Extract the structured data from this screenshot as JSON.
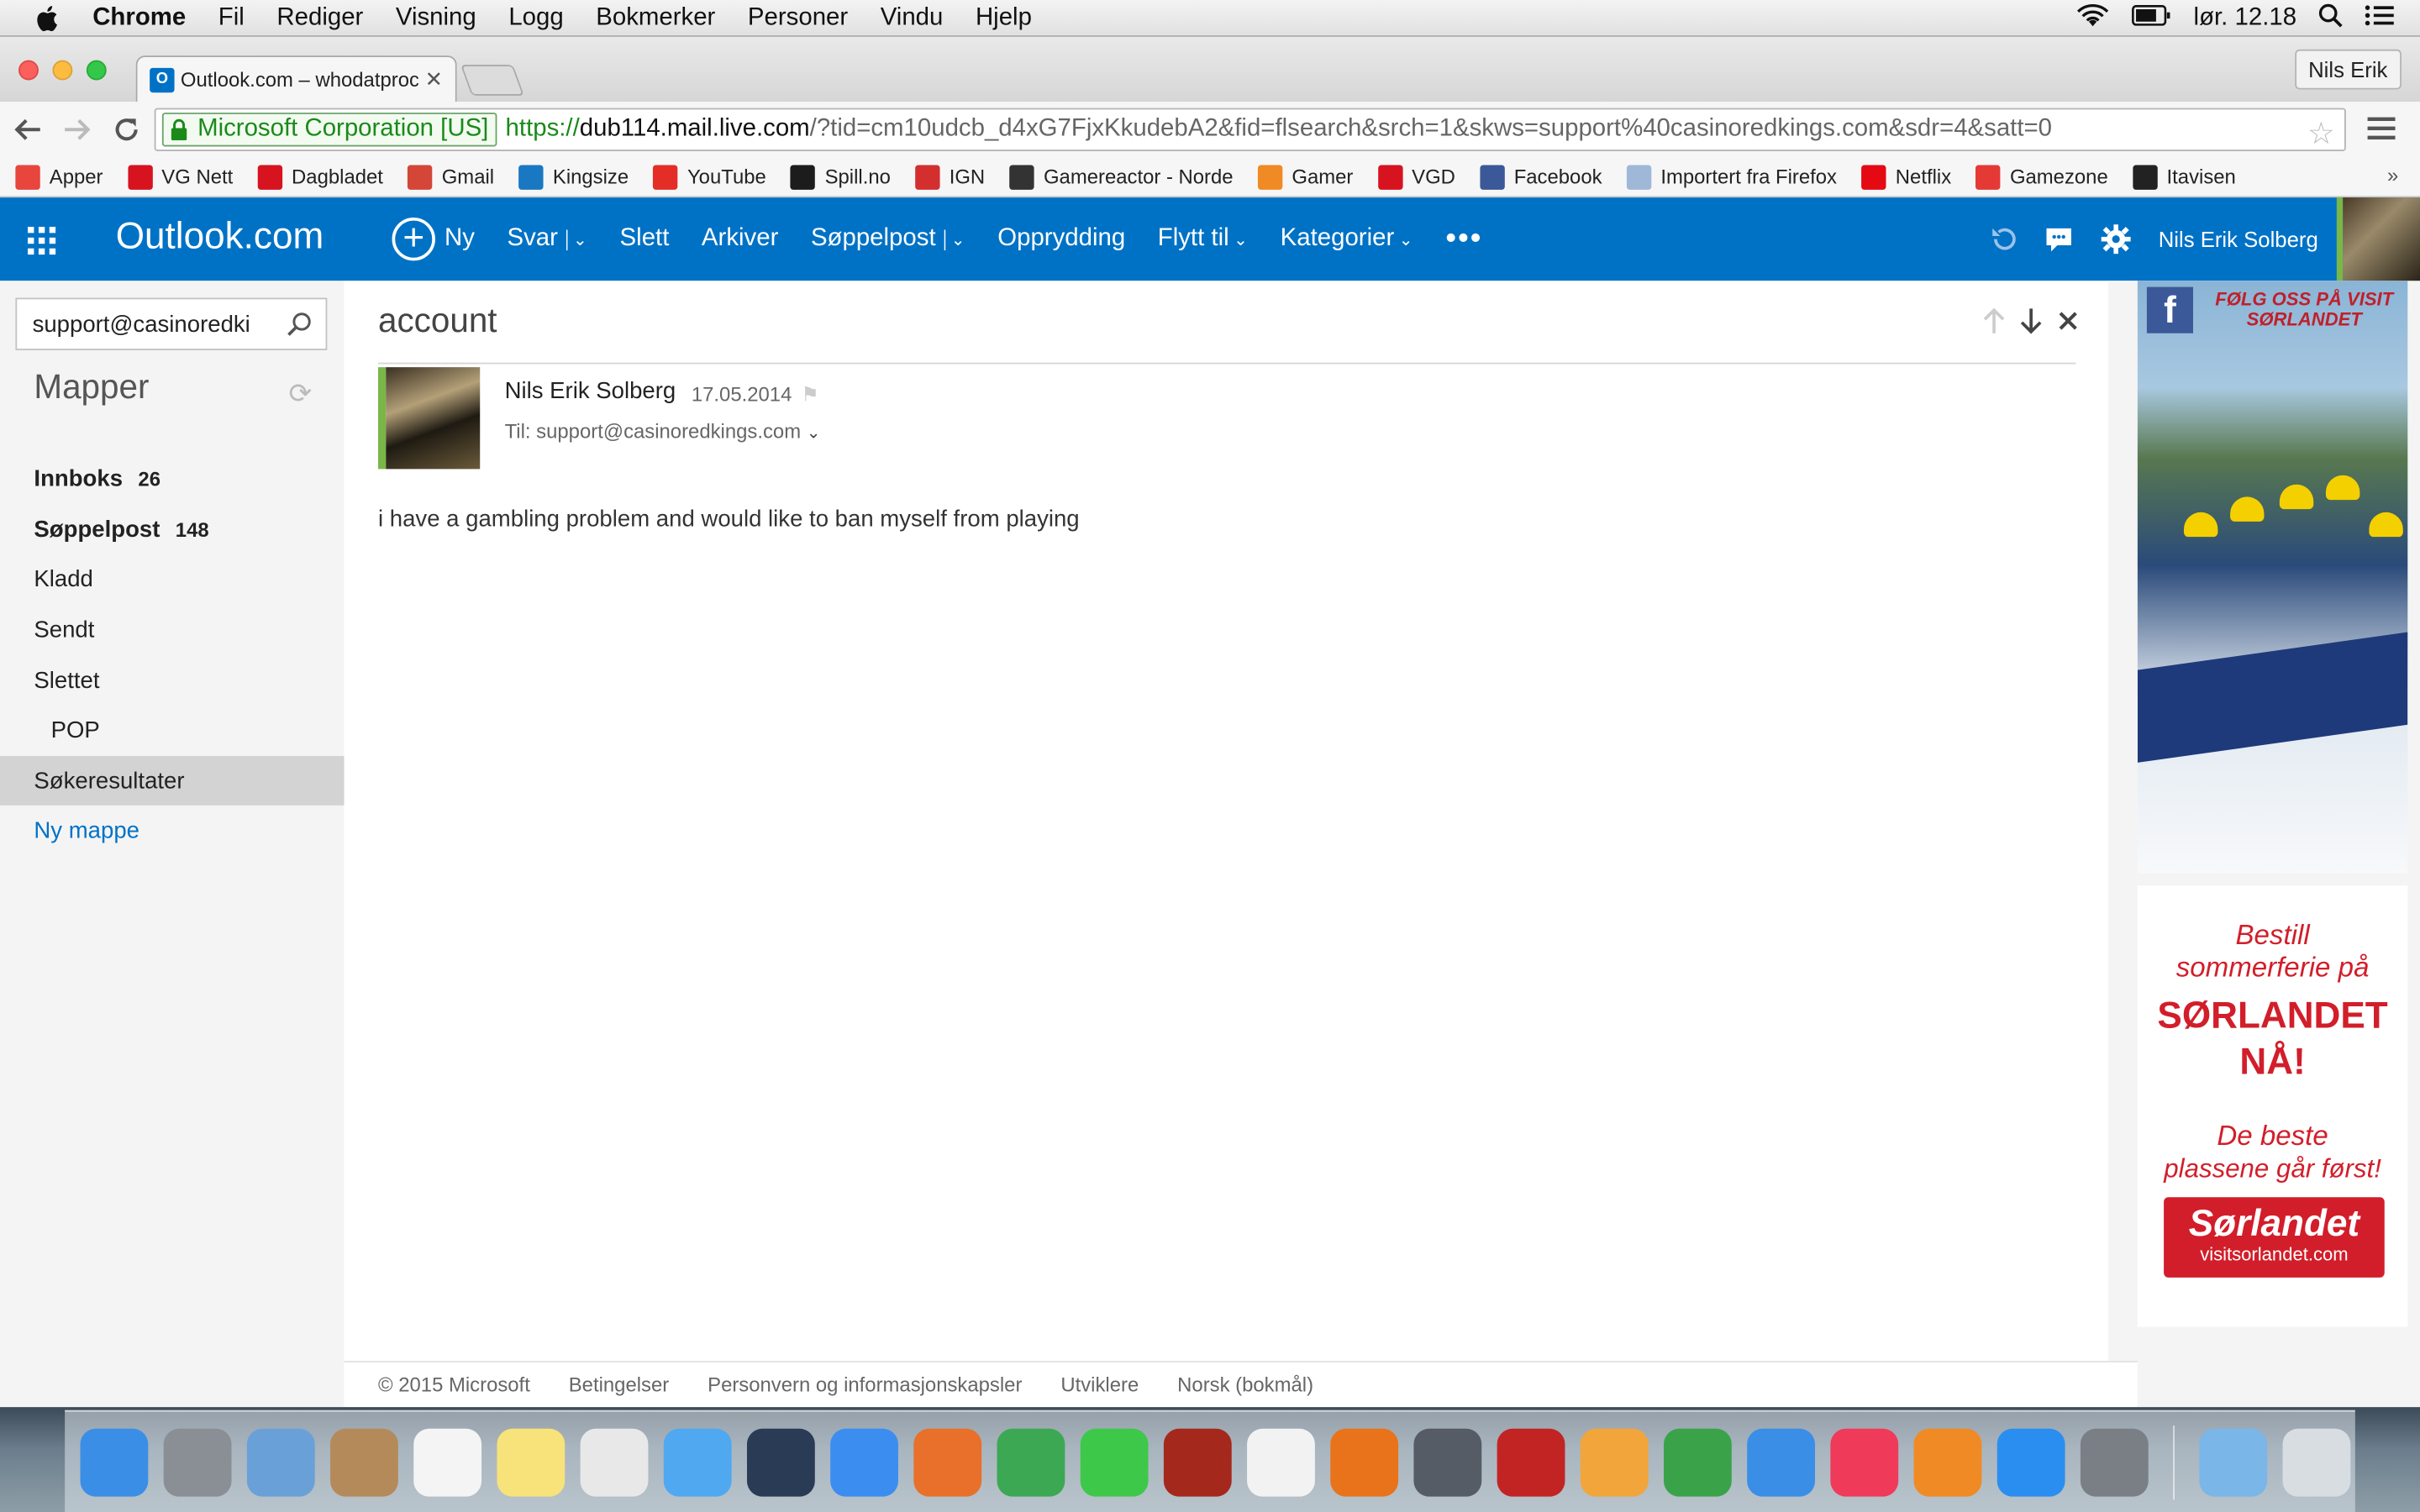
{
  "mac_menubar": {
    "app": "Chrome",
    "items": [
      "Fil",
      "Rediger",
      "Visning",
      "Logg",
      "Bokmerker",
      "Personer",
      "Vindu",
      "Hjelp"
    ],
    "clock": "lør. 12.18"
  },
  "browser": {
    "tab_title": "Outlook.com – whodatproc",
    "profile_name": "Nils Erik",
    "ev_label": "Microsoft Corporation [US]",
    "url_scheme": "https://",
    "url_host": "dub114.mail.live.com",
    "url_rest": "/?tid=cm10udcb_d4xG7FjxKkudebA2&fid=flsearch&srch=1&skws=support%40casinoredkings.com&sdr=4&satt=0",
    "bookmarks": [
      {
        "label": "Apper",
        "icon": "apps-grid-icon",
        "color": "#e8453c"
      },
      {
        "label": "VG Nett",
        "icon": "vg-icon",
        "color": "#d7131f"
      },
      {
        "label": "Dagbladet",
        "icon": "db-icon",
        "color": "#d7131f"
      },
      {
        "label": "Gmail",
        "icon": "gmail-icon",
        "color": "#d44638"
      },
      {
        "label": "Kingsize",
        "icon": "kingsize-icon",
        "color": "#1a78c2"
      },
      {
        "label": "YouTube",
        "icon": "youtube-icon",
        "color": "#e52d27"
      },
      {
        "label": "Spill.no",
        "icon": "spill-icon",
        "color": "#1c1c1c"
      },
      {
        "label": "IGN",
        "icon": "ign-icon",
        "color": "#d32f2f"
      },
      {
        "label": "Gamereactor - Norde",
        "icon": "gamereactor-icon",
        "color": "#333333"
      },
      {
        "label": "Gamer",
        "icon": "gamer-icon",
        "color": "#f08a24"
      },
      {
        "label": "VGD",
        "icon": "vgd-icon",
        "color": "#d7131f"
      },
      {
        "label": "Facebook",
        "icon": "facebook-icon",
        "color": "#3b5998"
      },
      {
        "label": "Importert fra Firefox",
        "icon": "folder-icon",
        "color": "#9fb8d8"
      },
      {
        "label": "Netflix",
        "icon": "netflix-icon",
        "color": "#e50914"
      },
      {
        "label": "Gamezone",
        "icon": "gamezone-icon",
        "color": "#e53935"
      },
      {
        "label": "Itavisen",
        "icon": "itavisen-icon",
        "color": "#222222"
      }
    ]
  },
  "outlook": {
    "brand": "Outlook.com",
    "commands": {
      "new": "Ny",
      "reply": "Svar",
      "delete": "Slett",
      "archive": "Arkiver",
      "junk": "Søppelpost",
      "sweep": "Opprydding",
      "move": "Flytt til",
      "categories": "Kategorier"
    },
    "user_name": "Nils Erik Solberg",
    "search_value": "support@casinoredki",
    "folders_heading": "Mapper",
    "folders": [
      {
        "label": "Innboks",
        "count": "26",
        "bold": true
      },
      {
        "label": "Søppelpost",
        "count": "148",
        "bold": true
      },
      {
        "label": "Kladd",
        "count": ""
      },
      {
        "label": "Sendt",
        "count": ""
      },
      {
        "label": "Slettet",
        "count": ""
      },
      {
        "label": "POP",
        "count": ""
      },
      {
        "label": "Søkeresultater",
        "count": "",
        "selected": true
      }
    ],
    "new_folder": "Ny mappe",
    "message": {
      "subject": "account",
      "sender": "Nils Erik Solberg",
      "date": "17.05.2014",
      "to": "Til: support@casinoredkings.com",
      "body": "i have a gambling problem and would like to ban myself from playing"
    },
    "footer": [
      "© 2015 Microsoft",
      "Betingelser",
      "Personvern og informasjonskapsler",
      "Utviklere",
      "Norsk (bokmål)"
    ]
  },
  "ad": {
    "top_text": "FØLG OSS PÅ VISIT SØRLANDET",
    "line1": "Bestill",
    "line2": "sommerferie på",
    "big1": "SØRLANDET",
    "big2": "NÅ!",
    "line3": "De beste",
    "line4": "plassene går først!",
    "btn_title": "Sørlandet",
    "btn_url": "visitsorlandet.com"
  },
  "dock": {
    "apps": [
      {
        "name": "finder-icon",
        "color": "#3a8ee6"
      },
      {
        "name": "launchpad-icon",
        "color": "#8a8f96"
      },
      {
        "name": "mail-icon",
        "color": "#6aa0d8"
      },
      {
        "name": "contacts-icon",
        "color": "#b58a5a"
      },
      {
        "name": "calendar-icon",
        "color": "#f4f4f4"
      },
      {
        "name": "notes-icon",
        "color": "#f8e27a"
      },
      {
        "name": "reminders-icon",
        "color": "#e8e8e8"
      },
      {
        "name": "messages-icon",
        "color": "#4fa8f0"
      },
      {
        "name": "quicktime-icon",
        "color": "#2a3b56"
      },
      {
        "name": "safari-icon",
        "color": "#3b8ef0"
      },
      {
        "name": "firefox-icon",
        "color": "#e8702a"
      },
      {
        "name": "chrome-icon",
        "color": "#3da854"
      },
      {
        "name": "facetime-icon",
        "color": "#3ec84a"
      },
      {
        "name": "photo-booth-icon",
        "color": "#a5281c"
      },
      {
        "name": "photos-icon",
        "color": "#f2f2f2"
      },
      {
        "name": "reason-icon",
        "color": "#e8731a"
      },
      {
        "name": "disk-utility-icon",
        "color": "#555c66"
      },
      {
        "name": "mpc-icon",
        "color": "#c22424"
      },
      {
        "name": "pages-icon",
        "color": "#f2a53a"
      },
      {
        "name": "numbers-icon",
        "color": "#3aa34a"
      },
      {
        "name": "keynote-icon",
        "color": "#3a8ee6"
      },
      {
        "name": "itunes-icon",
        "color": "#f03a5a"
      },
      {
        "name": "ibooks-icon",
        "color": "#f08a24"
      },
      {
        "name": "app-store-icon",
        "color": "#2a8ef0"
      },
      {
        "name": "system-preferences-icon",
        "color": "#7a7f86"
      }
    ],
    "trailing": [
      {
        "name": "downloads-folder-icon",
        "color": "#7ab6e8"
      },
      {
        "name": "trash-icon",
        "color": "#d8dde2"
      }
    ]
  }
}
